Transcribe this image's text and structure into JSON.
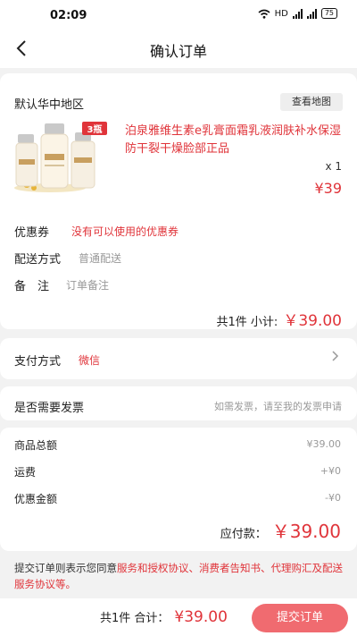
{
  "status_bar": {
    "time": "02:09",
    "network": "HD",
    "battery": "75"
  },
  "header": {
    "title": "确认订单"
  },
  "address": {
    "region": "默认华中地区",
    "map_button": "查看地图"
  },
  "product": {
    "title": "泊泉雅维生素e乳膏面霜乳液润肤补水保湿防干裂干燥脸部正品",
    "badge": "3瓶",
    "quantity": "x 1",
    "price": "¥39"
  },
  "order_options": {
    "coupon": {
      "label": "优惠券",
      "value": "没有可以使用的优惠券"
    },
    "delivery": {
      "label": "配送方式",
      "value": "普通配送"
    },
    "remark": {
      "label": "备　注",
      "placeholder": "订单备注"
    }
  },
  "subtotal": {
    "label": "共1件 小计:",
    "amount": "￥39.00"
  },
  "payment": {
    "label": "支付方式",
    "value": "微信"
  },
  "invoice": {
    "label": "是否需要发票",
    "hint": "如需发票，请至我的发票申请"
  },
  "summary": {
    "rows": [
      {
        "label": "商品总额",
        "value": "¥39.00"
      },
      {
        "label": "运费",
        "value": "+¥0"
      },
      {
        "label": "优惠金额",
        "value": "-¥0"
      }
    ],
    "due_label": "应付款：",
    "due_amount": "￥39.00"
  },
  "agreement": {
    "prefix": "提交订单则表示您同意",
    "links": "服务和授权协议、消费者告知书、代理购汇及配送服务协议等。"
  },
  "bottom_bar": {
    "total_label": "共1件 合计：",
    "total_amount": "¥39.00",
    "submit_label": "提交订单"
  },
  "colors": {
    "accent": "#e0343a",
    "submit_button": "#f06b70",
    "background": "#f2f2f2"
  }
}
